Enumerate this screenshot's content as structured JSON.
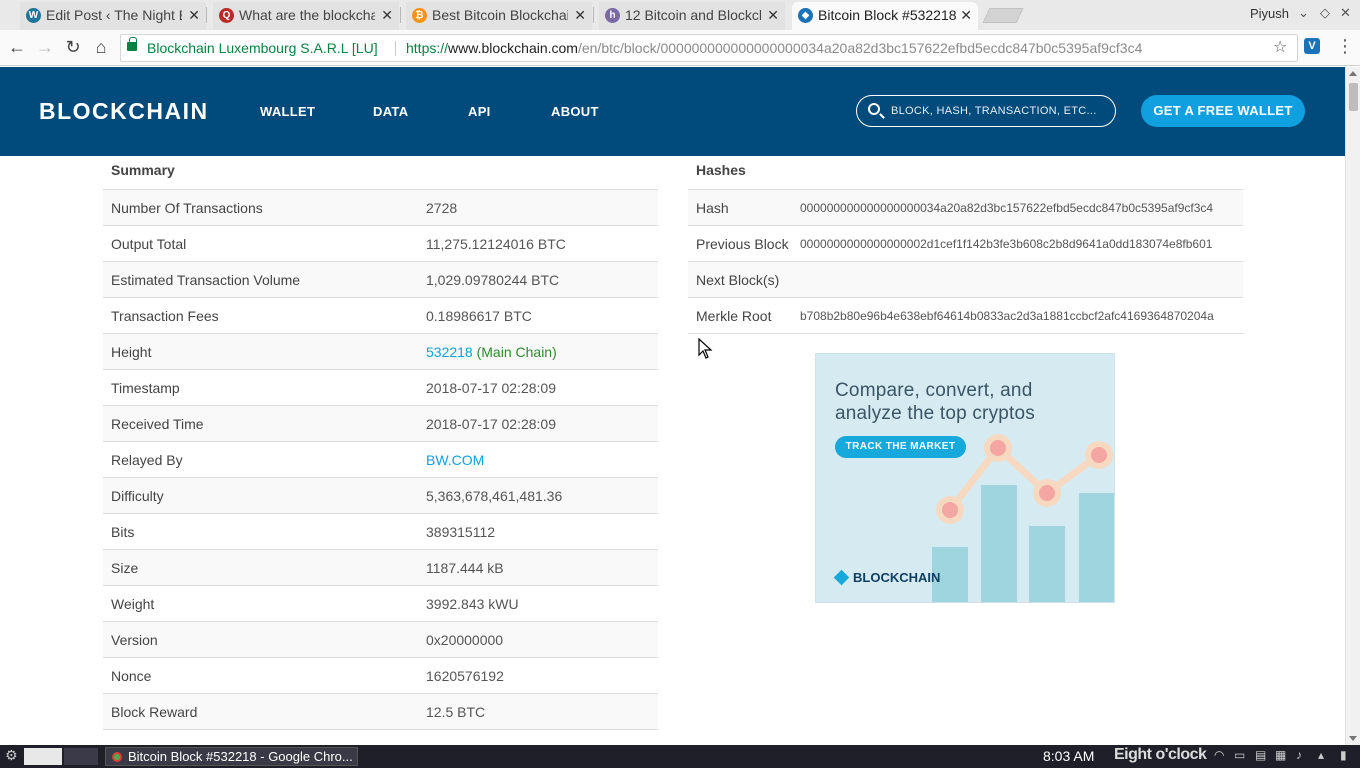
{
  "browser": {
    "tabs": [
      {
        "title": "Edit Post ‹ The Night B",
        "favicon": "wordpress-icon",
        "color": "#21759b",
        "glyph": "W"
      },
      {
        "title": "What are the blockcha",
        "favicon": "quora-icon",
        "color": "#b92b27",
        "glyph": "Q"
      },
      {
        "title": "Best Bitcoin Blockchair",
        "favicon": "bitcoin-icon",
        "color": "#f7931a",
        "glyph": "₿"
      },
      {
        "title": "12 Bitcoin and Blockch",
        "favicon": "hub-icon",
        "color": "#7b68a6",
        "glyph": "h"
      },
      {
        "title": "Bitcoin Block #532218",
        "favicon": "blockchain-icon",
        "color": "#1a73b8",
        "glyph": "◆"
      }
    ],
    "profile_name": "Piyush",
    "address_bar": {
      "ev_cert": "Blockchain Luxembourg S.A.R.L [LU]",
      "url_scheme": "https://",
      "url_host": "www.blockchain.com",
      "url_path": "/en/btc/block/000000000000000000034a20a82d3bc157622efbd5ecdc847b0c5395af9cf3c4"
    },
    "extension_badge": "V"
  },
  "site": {
    "logo": "BLOCKCHAIN",
    "nav": [
      "WALLET",
      "DATA",
      "API",
      "ABOUT"
    ],
    "search_placeholder": "BLOCK, HASH, TRANSACTION, ETC...",
    "cta": "GET A FREE WALLET",
    "brand_color": "#004a7c",
    "accent_color": "#10a0e0"
  },
  "summary": {
    "heading": "Summary",
    "rows": [
      {
        "label": "Number Of Transactions",
        "value": "2728"
      },
      {
        "label": "Output Total",
        "value": "11,275.12124016 BTC"
      },
      {
        "label": "Estimated Transaction Volume",
        "value": "1,029.09780244 BTC"
      },
      {
        "label": "Transaction Fees",
        "value": "0.18986617 BTC"
      },
      {
        "label": "Height",
        "value": "532218",
        "suffix": "(Main Chain)"
      },
      {
        "label": "Timestamp",
        "value": "2018-07-17 02:28:09"
      },
      {
        "label": "Received Time",
        "value": "2018-07-17 02:28:09"
      },
      {
        "label": "Relayed By",
        "value": "BW.COM"
      },
      {
        "label": "Difficulty",
        "value": "5,363,678,461,481.36"
      },
      {
        "label": "Bits",
        "value": "389315112"
      },
      {
        "label": "Size",
        "value": "1187.444 kB"
      },
      {
        "label": "Weight",
        "value": "3992.843 kWU"
      },
      {
        "label": "Version",
        "value": "0x20000000"
      },
      {
        "label": "Nonce",
        "value": "1620576192"
      },
      {
        "label": "Block Reward",
        "value": "12.5 BTC"
      }
    ]
  },
  "hashes": {
    "heading": "Hashes",
    "rows": [
      {
        "label": "Hash",
        "value": "000000000000000000034a20a82d3bc157622efbd5ecdc847b0c5395af9cf3c4"
      },
      {
        "label": "Previous Block",
        "value": "0000000000000000002d1cef1f142b3fe3b608c2b8d9641a0dd183074e8fb601"
      },
      {
        "label": "Next Block(s)",
        "value": ""
      },
      {
        "label": "Merkle Root",
        "value": "b708b2b80e96b4e638ebf64614b0833ac2d3a1881ccbcf2afc4169364870204a"
      }
    ]
  },
  "ad": {
    "line1": "Compare, convert, and",
    "line2": "analyze the top cryptos",
    "button": "TRACK THE MARKET",
    "logo": "BLOCKCHAIN"
  },
  "taskbar": {
    "task_title": "Bitcoin Block #532218 - Google Chro...",
    "time": "8:03 AM",
    "phrase": "Eight o'clock"
  }
}
